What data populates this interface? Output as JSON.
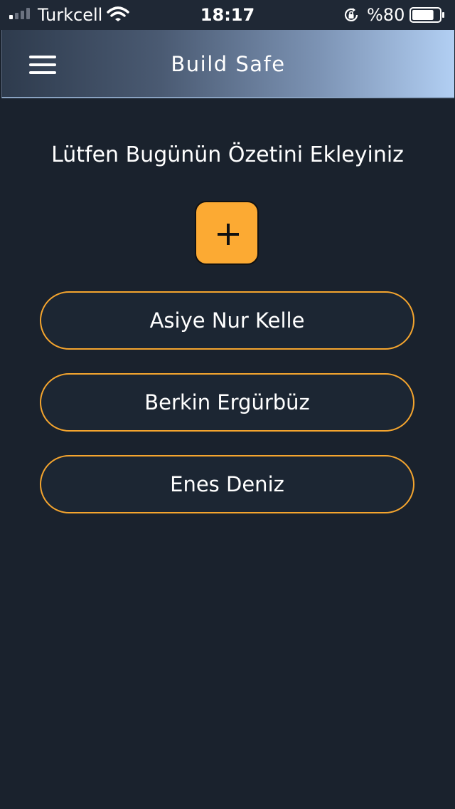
{
  "status_bar": {
    "carrier": "Turkcell",
    "time": "18:17",
    "battery_percent": "%80",
    "battery_level": 0.8,
    "signal_bars_active": 1,
    "signal_bars_total": 4,
    "icons": [
      "signal-icon",
      "wifi-icon",
      "orientation-lock-icon",
      "battery-icon"
    ]
  },
  "nav": {
    "title": "Build Safe",
    "menu_icon": "hamburger-menu-icon"
  },
  "main": {
    "prompt": "Lütfen Bugünün Özetini Ekleyiniz",
    "add_button_icon": "plus-icon",
    "people": [
      {
        "name": "Asiye Nur Kelle"
      },
      {
        "name": "Berkin Ergürbüz"
      },
      {
        "name": "Enes Deniz"
      }
    ]
  },
  "colors": {
    "background": "#1a222d",
    "accent": "#fcaa33",
    "button_border": "#f5a52e",
    "nav_gradient_start": "#2e3b4d",
    "nav_gradient_end": "#b2cff3"
  }
}
